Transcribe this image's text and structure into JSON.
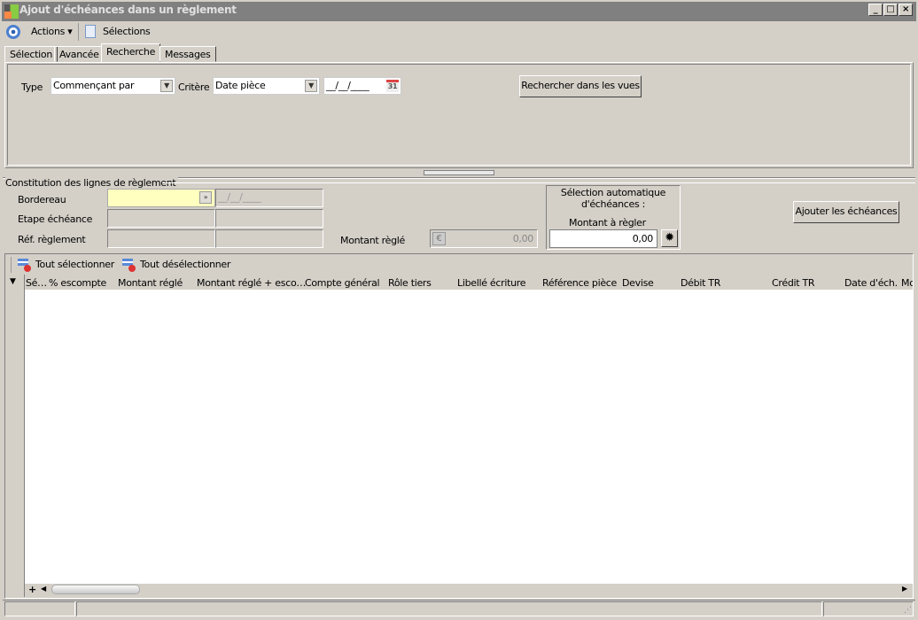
{
  "window": {
    "title": "Ajout d'échéances dans un règlement"
  },
  "toolbar": {
    "actions": "Actions",
    "selections": "Sélections"
  },
  "tabs": [
    {
      "label": "Sélection"
    },
    {
      "label": "Avancée"
    },
    {
      "label": "Recherche"
    },
    {
      "label": "Messages"
    }
  ],
  "search": {
    "type_label": "Type",
    "type_value": "Commençant par",
    "critere_label": "Critère",
    "critere_value": "Date pièce",
    "date_value": "__/__/____",
    "calendar_day": "31",
    "search_button": "Rechercher dans les vues"
  },
  "constitution": {
    "legend": "Constitution des lignes de règlement",
    "bordereau_label": "Bordereau",
    "bordereau_date": "__/__/____",
    "etape_label": "Etape échéance",
    "ref_label": "Réf. règlement",
    "montant_regle_label": "Montant règlé",
    "montant_regle_value": "0,00"
  },
  "auto": {
    "title": "Sélection automatique d'échéances :",
    "montant_label": "Montant à règler",
    "montant_value": "0,00"
  },
  "add_button": "Ajouter les échéances",
  "grid": {
    "select_all": "Tout sélectionner",
    "deselect_all": "Tout désélectionner",
    "columns": [
      "Sé…",
      "% escompte",
      "Montant réglé",
      "Montant réglé + esco…",
      "Compte général",
      "Rôle tiers",
      "Libellé écriture",
      "Référence pièce",
      "Devise",
      "Débit TR",
      "Crédit TR",
      "Date d'éch.",
      "Mo"
    ]
  }
}
